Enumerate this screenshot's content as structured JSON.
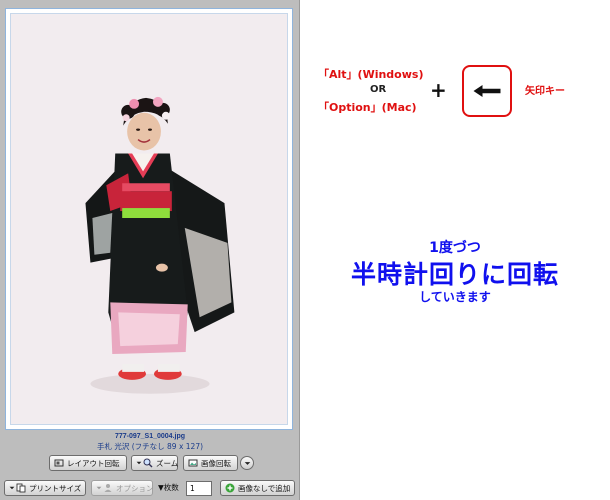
{
  "viewer": {
    "filename": "777-097_S1_0004.jpg",
    "caption": "手札 光沢 (フチなし 89 x 127)"
  },
  "toolbar": {
    "layout_rotate": "レイアウト回転",
    "zoom": "ズーム",
    "image_rotate": "画像回転",
    "print_size": "プリントサイズ",
    "option": "オプション",
    "copies_label": "▼枚数",
    "copies_value": "1",
    "add_no_image": "画像なしで追加"
  },
  "instruction": {
    "key_alt": "「Alt」(Windows)",
    "or": "OR",
    "key_option": "「Option」(Mac)",
    "plus": "+",
    "arrow_label": "矢印キー",
    "line1": "1度づつ",
    "line2": "半時計回りに回転",
    "line3": "していきます"
  },
  "colors": {
    "accent_red": "#e01010",
    "accent_blue": "#1010ee",
    "panel_gray": "#bdbdbd"
  }
}
